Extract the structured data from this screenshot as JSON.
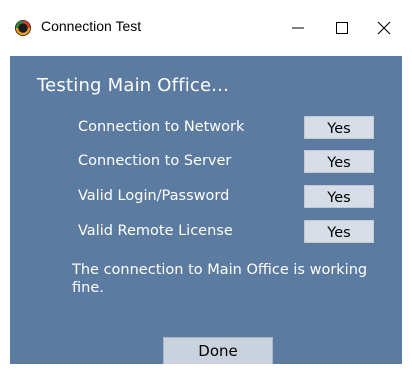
{
  "window": {
    "title": "Connection Test",
    "icon": "app-ring-icon",
    "controls": {
      "minimize": "minimize-icon",
      "maximize": "maximize-icon",
      "close": "close-icon"
    }
  },
  "dialog": {
    "heading": "Testing Main Office...",
    "checks": [
      {
        "label": "Connection to Network",
        "value": "Yes"
      },
      {
        "label": "Connection to Server",
        "value": "Yes"
      },
      {
        "label": "Valid Login/Password",
        "value": "Yes"
      },
      {
        "label": "Valid Remote License",
        "value": "Yes"
      }
    ],
    "message": "The connection to Main Office is working fine.",
    "done_label": "Done"
  },
  "colors": {
    "panel_bg": "#5c7ba1",
    "value_box_bg": "#d6dde6",
    "button_bg": "#c9d2dd",
    "text_light": "#ffffff"
  }
}
